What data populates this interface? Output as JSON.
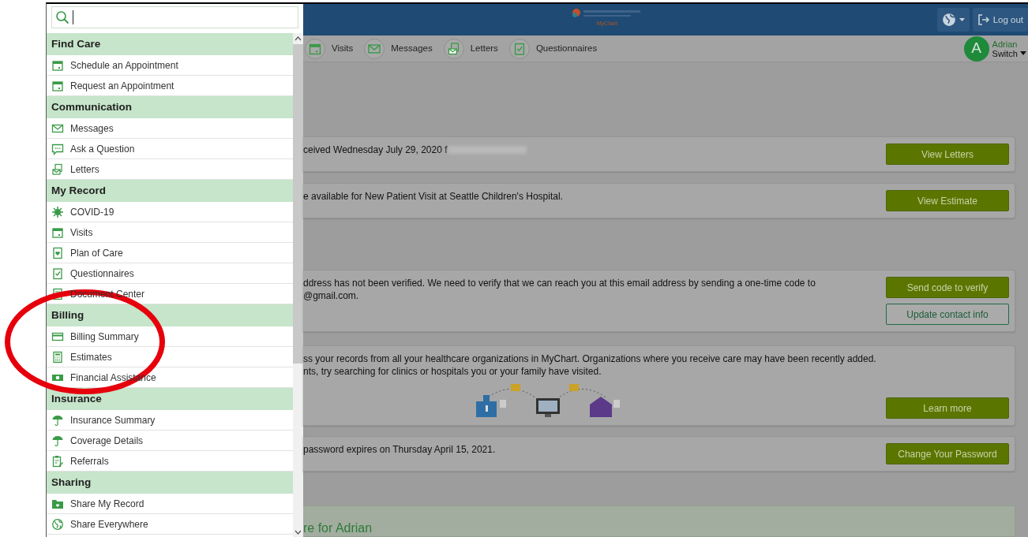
{
  "search": {
    "focused": true
  },
  "menu": {
    "sections": [
      {
        "title": "Find Care",
        "items": [
          {
            "label": "Schedule an Appointment",
            "kind": "calendar"
          },
          {
            "label": "Request an Appointment",
            "kind": "calendar"
          }
        ]
      },
      {
        "title": "Communication",
        "items": [
          {
            "label": "Messages",
            "kind": "envelope"
          },
          {
            "label": "Ask a Question",
            "kind": "chat"
          },
          {
            "label": "Letters",
            "kind": "letter"
          }
        ]
      },
      {
        "title": "My Record",
        "items": [
          {
            "label": "COVID-19",
            "kind": "virus"
          },
          {
            "label": "Visits",
            "kind": "calendar"
          },
          {
            "label": "Plan of Care",
            "kind": "heartdoc"
          },
          {
            "label": "Questionnaires",
            "kind": "checklist"
          },
          {
            "label": "Document Center",
            "kind": "document"
          }
        ]
      },
      {
        "title": "Billing",
        "items": [
          {
            "label": "Billing Summary",
            "kind": "card"
          },
          {
            "label": "Estimates",
            "kind": "calculator"
          },
          {
            "label": "Financial Assistance",
            "kind": "money"
          }
        ]
      },
      {
        "title": "Insurance",
        "items": [
          {
            "label": "Insurance Summary",
            "kind": "umbrella"
          },
          {
            "label": "Coverage Details",
            "kind": "umbrella"
          },
          {
            "label": "Referrals",
            "kind": "clipboard"
          }
        ]
      },
      {
        "title": "Sharing",
        "items": [
          {
            "label": "Share My Record",
            "kind": "folder"
          },
          {
            "label": "Share Everywhere",
            "kind": "globe"
          }
        ]
      }
    ]
  },
  "header": {
    "logo_caption": "MyChart",
    "logout": "Log out"
  },
  "nav": [
    {
      "label": "Visits",
      "kind": "calendar"
    },
    {
      "label": "Messages",
      "kind": "envelope"
    },
    {
      "label": "Letters",
      "kind": "letter"
    },
    {
      "label": "Questionnaires",
      "kind": "checklist"
    }
  ],
  "user": {
    "initial": "A",
    "name": "Adrian",
    "action": "Switch"
  },
  "cards": [
    {
      "kind": "notice",
      "lines": [
        "ceived Wednesday July 29, 2020 f"
      ],
      "redacted": true,
      "buttons": [
        {
          "label": "View Letters",
          "kind": "filled"
        }
      ]
    },
    {
      "kind": "notice",
      "lines": [
        "e available for New Patient Visit at Seattle Children's Hospital."
      ],
      "buttons": [
        {
          "label": "View Estimate",
          "kind": "filled"
        }
      ]
    },
    {
      "kind": "notice",
      "lines": [
        "ddress has not been verified. We need to verify that we can reach you at this email address by sending a one-time code to",
        "@gmail.com."
      ],
      "buttons": [
        {
          "label": "Send code to verify",
          "kind": "filled"
        },
        {
          "label": "Update contact info",
          "kind": "outline"
        }
      ]
    },
    {
      "kind": "notice",
      "lines": [
        "ss your records from all your healthcare organizations in MyChart. Organizations where you receive care may have been recently added.",
        "nts, try searching for clinics or hospitals you or your family have visited."
      ],
      "illustration": true,
      "buttons": [
        {
          "label": "Learn more",
          "kind": "filled"
        }
      ]
    },
    {
      "kind": "notice",
      "lines": [
        "password expires on Thursday April 15, 2021."
      ],
      "buttons": [
        {
          "label": "Change Your Password",
          "kind": "filled"
        }
      ]
    },
    {
      "kind": "banner",
      "lines": [
        "re for Adrian"
      ]
    }
  ],
  "annotation": {
    "kind": "ellipse"
  }
}
